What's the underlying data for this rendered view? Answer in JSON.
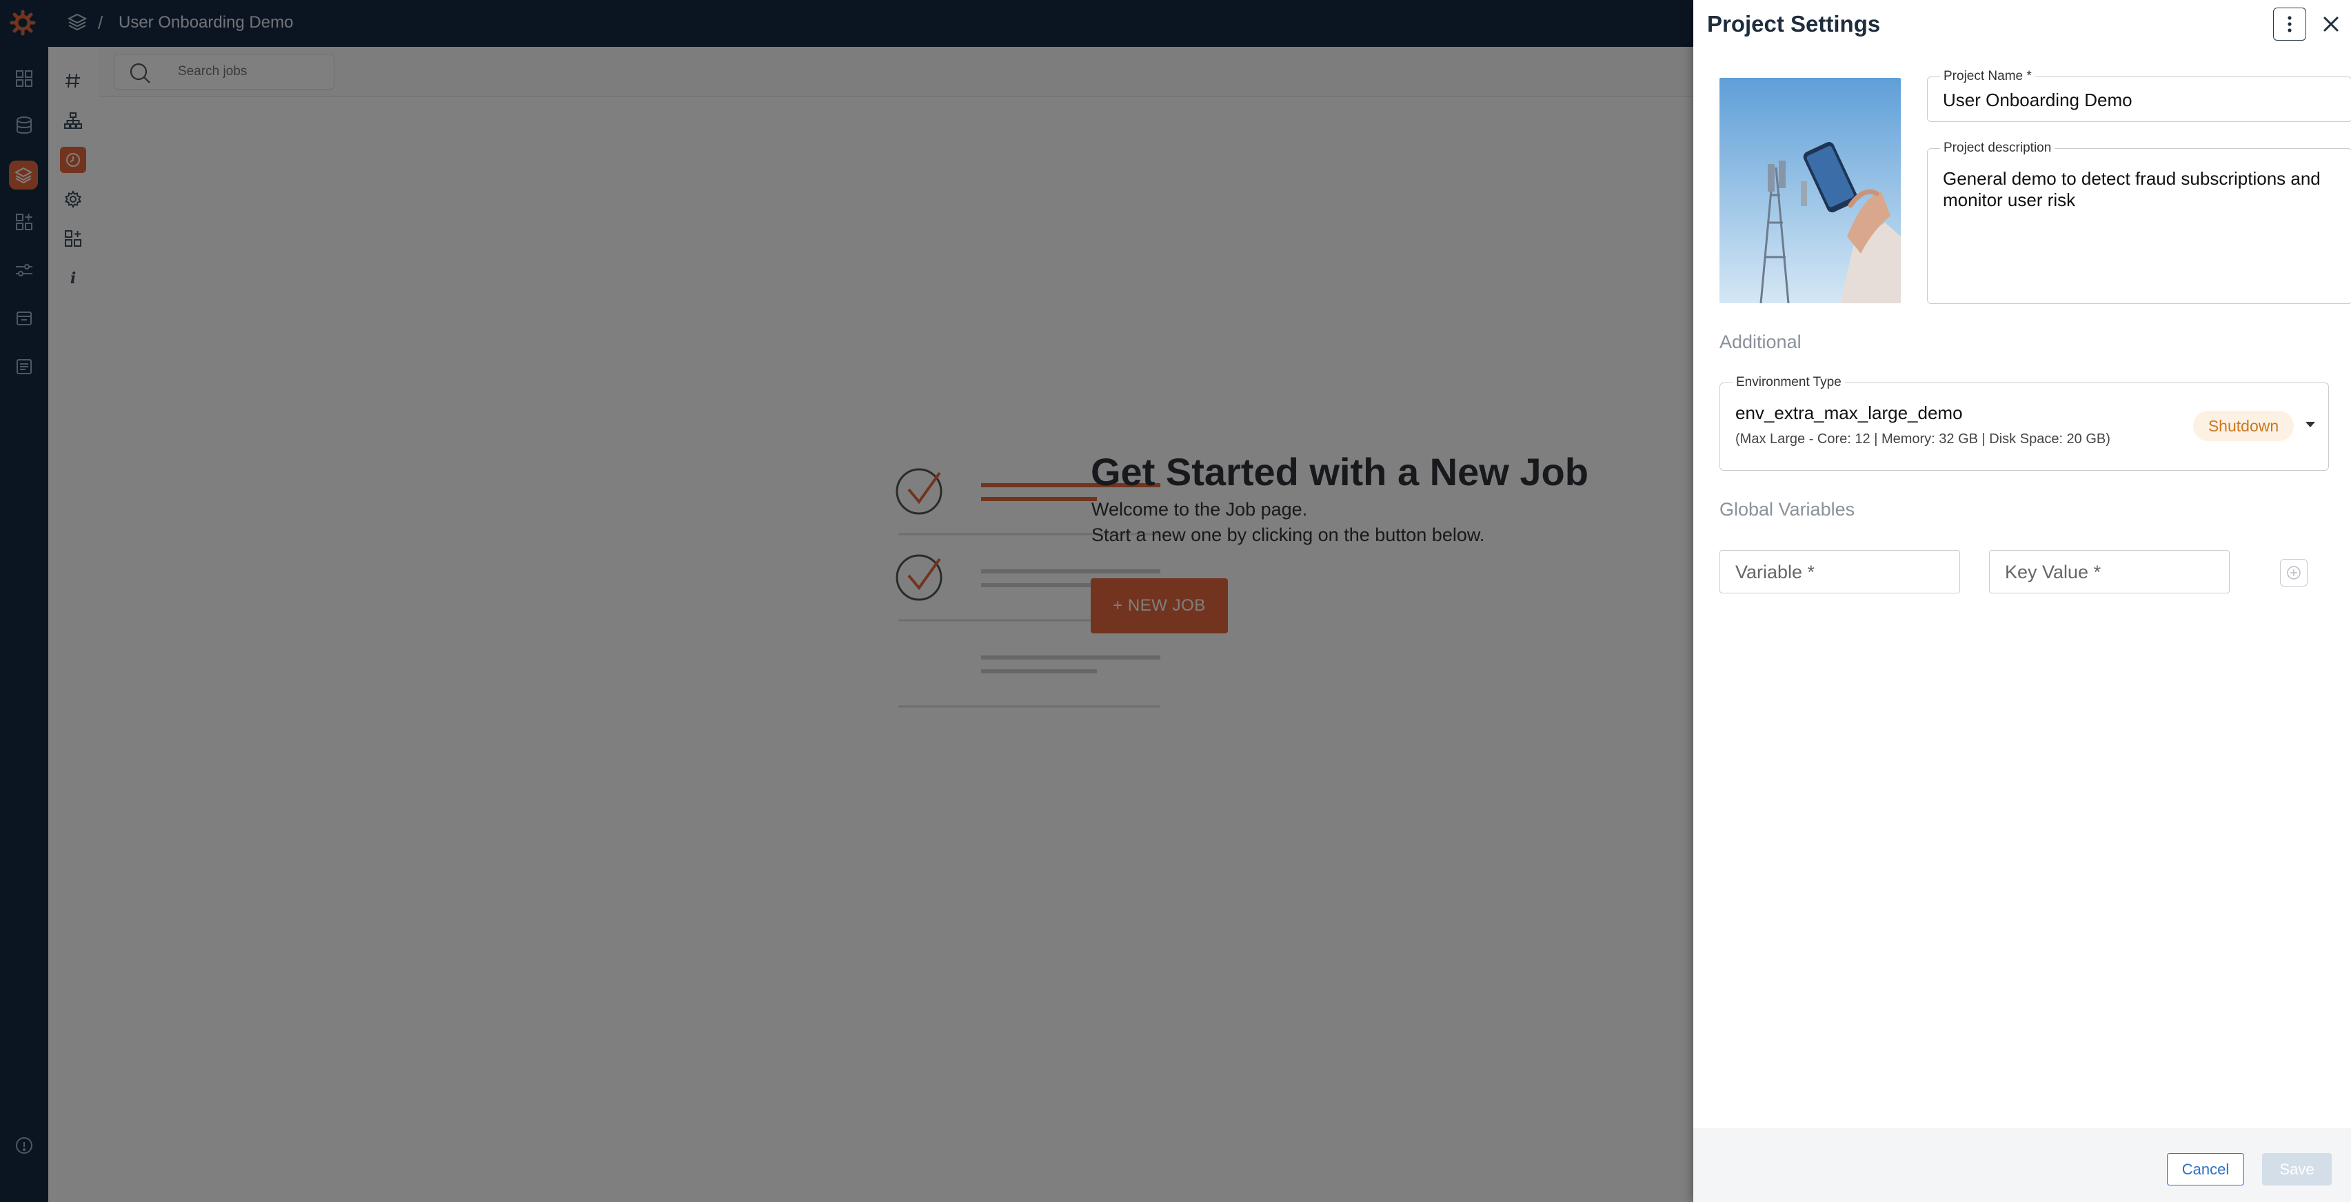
{
  "header": {
    "breadcrumb_separator": "/",
    "project_title": "User Onboarding Demo",
    "logo_icon": "app-logo-icon",
    "breadcrumb_icon": "layers-icon"
  },
  "left_rail": {
    "icons": [
      "dashboard-icon",
      "database-icon",
      "projects-icon",
      "apps-icon",
      "settings-sliders-icon",
      "archive-icon",
      "documents-icon",
      "help-icon"
    ],
    "active": "projects-icon"
  },
  "sub_rail": {
    "icons": [
      "canvas-icon",
      "dataset-tree-icon",
      "jobs-icon",
      "gear-icon",
      "add-app-icon",
      "info-icon"
    ],
    "active": "jobs-icon"
  },
  "search": {
    "placeholder": "Search jobs"
  },
  "empty_state": {
    "title": "Get Started with a New Job",
    "line1": "Welcome to the Job page.",
    "line2": "Start a new one by clicking on the button below.",
    "button_label": "+ NEW JOB"
  },
  "drawer": {
    "title": "Project Settings",
    "project_name_label": "Project Name *",
    "project_name_value": "User Onboarding Demo",
    "project_description_label": "Project description",
    "project_description_value": "General demo to detect fraud subscriptions and monitor user risk",
    "additional_label": "Additional",
    "environment_type_label": "Environment Type",
    "environment_name": "env_extra_max_large_demo",
    "environment_details": "(Max Large - Core: 12 | Memory: 32 GB | Disk Space: 20 GB)",
    "environment_status": "Shutdown",
    "global_variables_label": "Global Variables",
    "variable_placeholder": "Variable *",
    "key_value_placeholder": "Key Value *",
    "cancel_label": "Cancel",
    "save_label": "Save"
  },
  "colors": {
    "accent": "#e5683d",
    "nav_background": "#172b44",
    "status_text": "#c9781f",
    "status_background": "#fdf1e3",
    "link_blue": "#2a6fc9"
  }
}
